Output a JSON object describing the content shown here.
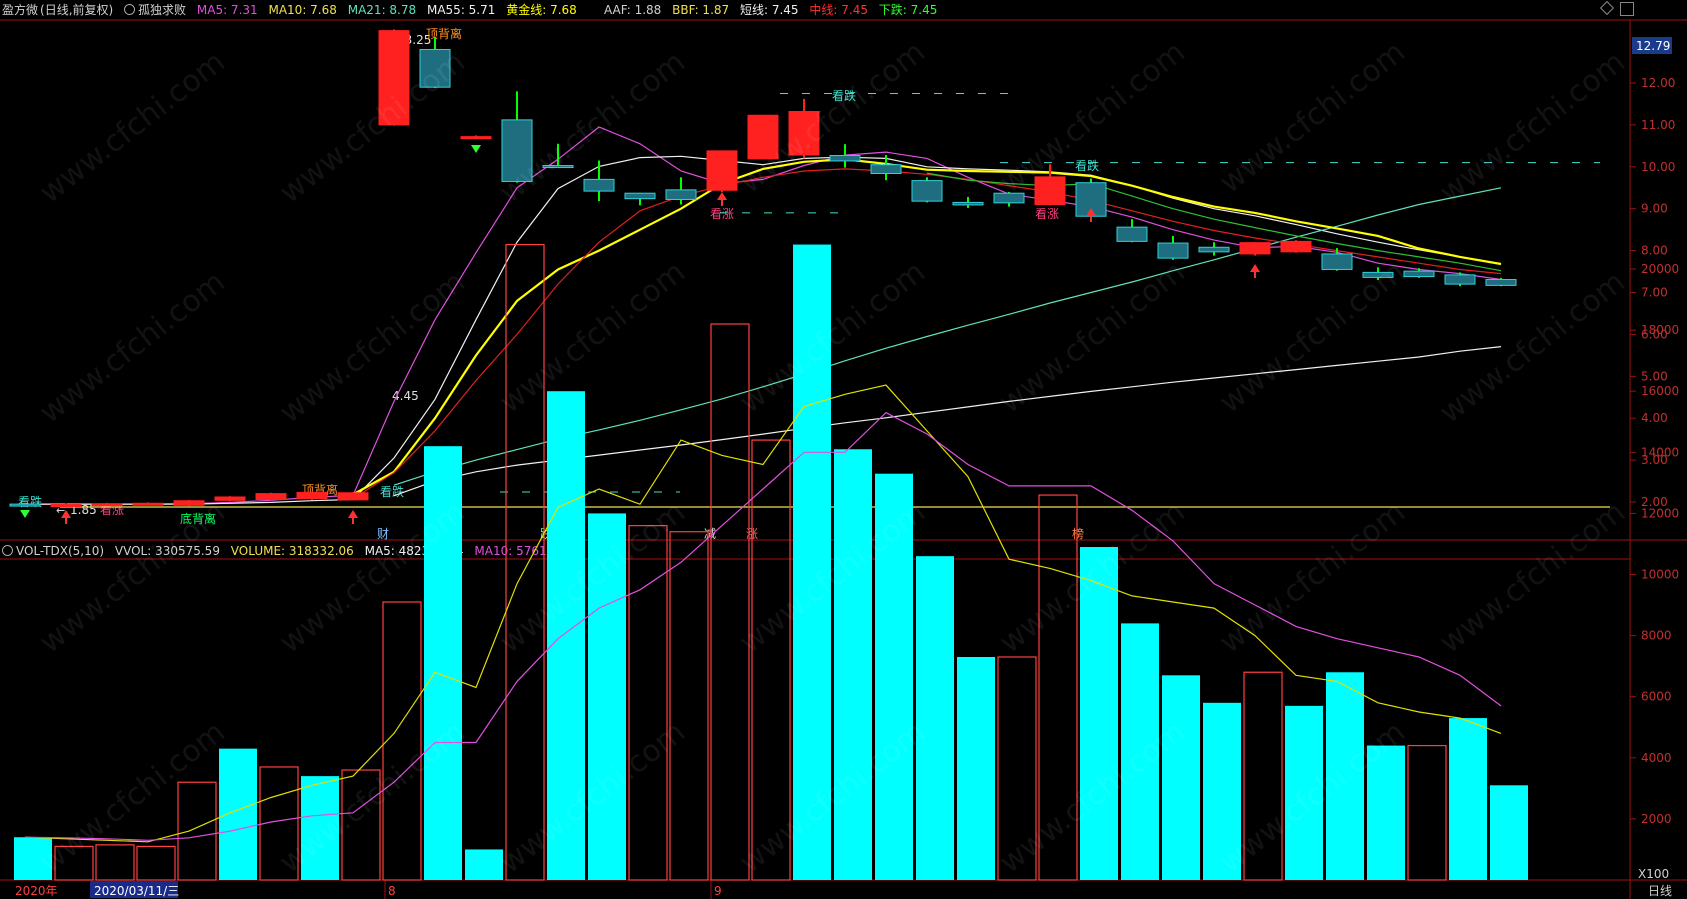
{
  "header": {
    "stock": "盈方微",
    "period": "(日线,前复权)",
    "indicator_icon": "circle-icon",
    "indicator_name": "孤独求败",
    "ma5": "MA5: 7.31",
    "ma10": "MA10: 7.68",
    "ma21": "MA21: 8.78",
    "ma55": "MA55: 5.71",
    "golden": "黄金线: 7.68",
    "aaf": "AAF: 1.88",
    "bbf": "BBF: 1.87",
    "short": "短线: 7.45",
    "mid": "中线: 7.45",
    "down": "下跌: 7.45"
  },
  "vol_header": {
    "name": "VOL-TDX(5,10)",
    "vvol": "VVOL: 330575.59",
    "volume": "VOLUME: 318332.06",
    "ma5": "MA5: 482360.94",
    "ma10": "MA10: 576196.13"
  },
  "colors": {
    "up": "#ff2020",
    "down_fill": "#1e6e80",
    "down_edge": "#2fd0d8",
    "green_tick": "#00ff00",
    "ma5": "#e050e0",
    "ma10": "#f0f0f0",
    "ma21": "#60e0c0",
    "ma55": "#f0f0f0",
    "golden": "#ffff00",
    "red_line": "#e02020",
    "vol_up": "#ff4040",
    "vol_down": "#00ffff",
    "axis": "#a01010"
  },
  "footer": {
    "year": "2020年",
    "date": "2020/03/11/三",
    "month8": "8",
    "month9": "9",
    "scale": "X100",
    "period_label": "日线"
  },
  "labels": {
    "price_badge": "12.79",
    "high": "13.25",
    "low": "1.85",
    "mid_mark": "4.45",
    "top_div1": "顶背离",
    "top_div2": "顶背离",
    "bottom_div": "底背离",
    "watch_up1": "看涨",
    "watch_up2": "看涨",
    "watch_up3": "看涨",
    "watch_down1": "看跌",
    "watch_down2": "看跌",
    "watch_down3": "看跌",
    "watch_down4": "看跌",
    "e1": "财",
    "e2": "跌",
    "e3": "减",
    "e4": "涨",
    "e5": "榜",
    "watermark": "www.cfchi.com"
  },
  "chart_data": [
    {
      "type": "candlestick",
      "title": "盈方微 (日线,前复权)",
      "y_ticks": [
        2.0,
        3.0,
        4.0,
        5.0,
        6.0,
        7.0,
        8.0,
        9.0,
        10.0,
        11.0,
        12.0
      ],
      "ylim": [
        1.6,
        13.3
      ],
      "candles": [
        [
          1.95,
          1.93,
          1.98,
          1.9
        ],
        [
          1.93,
          1.94,
          1.97,
          1.91
        ],
        [
          1.95,
          1.96,
          1.98,
          1.92
        ],
        [
          1.96,
          1.97,
          1.99,
          1.94
        ],
        [
          1.92,
          2.03,
          2.05,
          1.9
        ],
        [
          2.04,
          2.12,
          2.14,
          2.02
        ],
        [
          2.06,
          2.2,
          2.22,
          2.03
        ],
        [
          2.08,
          2.23,
          2.25,
          2.05
        ],
        [
          2.05,
          2.22,
          2.24,
          2.04
        ],
        [
          11.0,
          13.25,
          13.28,
          10.98
        ],
        [
          12.8,
          11.9,
          13.1,
          11.88
        ],
        [
          10.68,
          10.72,
          10.75,
          10.66
        ],
        [
          11.12,
          9.65,
          11.8,
          9.62
        ],
        [
          10.03,
          10.02,
          10.55,
          10.0
        ],
        [
          9.7,
          9.42,
          10.15,
          9.18
        ],
        [
          9.37,
          9.24,
          9.38,
          9.08
        ],
        [
          9.45,
          9.22,
          9.75,
          9.1
        ],
        [
          9.44,
          10.38,
          10.38,
          9.4
        ],
        [
          10.19,
          11.23,
          11.24,
          10.18
        ],
        [
          10.28,
          11.32,
          11.62,
          10.2
        ],
        [
          10.27,
          10.14,
          10.54,
          9.98
        ],
        [
          10.05,
          9.84,
          10.28,
          9.68
        ],
        [
          9.67,
          9.18,
          9.75,
          9.15
        ],
        [
          9.15,
          9.09,
          9.28,
          9.02
        ],
        [
          9.37,
          9.14,
          9.4,
          9.05
        ],
        [
          9.1,
          9.76,
          10.06,
          9.08
        ],
        [
          9.62,
          8.82,
          9.72,
          8.8
        ],
        [
          8.56,
          8.22,
          8.75,
          8.2
        ],
        [
          8.18,
          7.82,
          8.35,
          7.78
        ],
        [
          8.08,
          7.97,
          8.2,
          7.88
        ],
        [
          7.92,
          8.19,
          8.2,
          7.88
        ],
        [
          7.97,
          8.22,
          8.25,
          7.95
        ],
        [
          7.92,
          7.55,
          8.06,
          7.52
        ],
        [
          7.48,
          7.36,
          7.6,
          7.3
        ],
        [
          7.51,
          7.38,
          7.58,
          7.35
        ],
        [
          7.42,
          7.2,
          7.48,
          7.15
        ],
        [
          7.31,
          7.17,
          7.35,
          7.15
        ]
      ],
      "series": [
        {
          "name": "MA5",
          "values": [
            1.95,
            1.95,
            1.95,
            1.95,
            1.96,
            1.99,
            2.04,
            2.11,
            2.16,
            4.4,
            6.35,
            7.95,
            9.5,
            10.18,
            10.95,
            10.55,
            9.9,
            9.6,
            9.7,
            10.03,
            10.28,
            10.35,
            10.2,
            9.75,
            9.35,
            9.2,
            9.05,
            8.8,
            8.5,
            8.25,
            8.07,
            8.1,
            7.96,
            7.7,
            7.55,
            7.45,
            7.31
          ]
        },
        {
          "name": "MA10",
          "values": [
            1.95,
            1.95,
            1.95,
            1.95,
            1.95,
            1.97,
            1.99,
            2.03,
            2.06,
            3.05,
            4.45,
            6.35,
            8.2,
            9.48,
            10.01,
            10.22,
            10.25,
            10.15,
            10.05,
            10.2,
            10.23,
            10.2,
            10.0,
            9.95,
            9.92,
            9.88,
            9.8,
            9.55,
            9.25,
            9.0,
            8.83,
            8.62,
            8.4,
            8.2,
            8.02,
            7.85,
            7.68
          ]
        },
        {
          "name": "MA21",
          "values": [
            null,
            null,
            null,
            null,
            null,
            null,
            null,
            null,
            null,
            2.4,
            2.72,
            3.0,
            3.25,
            3.5,
            3.72,
            3.95,
            4.2,
            4.46,
            4.75,
            5.05,
            5.37,
            5.67,
            5.95,
            6.22,
            6.48,
            6.75,
            7.0,
            7.25,
            7.52,
            7.78,
            8.05,
            8.32,
            8.58,
            8.85,
            9.1,
            9.3,
            9.5
          ]
        },
        {
          "name": "MA55",
          "values": [
            null,
            null,
            null,
            null,
            null,
            null,
            null,
            null,
            null,
            2.15,
            2.5,
            2.72,
            2.88,
            3.0,
            3.12,
            3.24,
            3.36,
            3.49,
            3.62,
            3.76,
            3.89,
            4.01,
            4.14,
            4.27,
            4.4,
            4.52,
            4.64,
            4.75,
            4.86,
            4.96,
            5.06,
            5.16,
            5.26,
            5.36,
            5.46,
            5.6,
            5.71
          ]
        },
        {
          "name": "黄金线",
          "values": [
            null,
            null,
            null,
            null,
            null,
            null,
            null,
            null,
            2.18,
            2.72,
            4.0,
            5.5,
            6.8,
            7.55,
            8.0,
            8.5,
            9.0,
            9.6,
            9.95,
            10.12,
            10.18,
            10.07,
            9.93,
            9.9,
            9.88,
            9.86,
            9.78,
            9.55,
            9.28,
            9.05,
            8.9,
            8.7,
            8.53,
            8.35,
            8.05,
            7.85,
            7.68
          ]
        },
        {
          "name": "红线",
          "values": [
            null,
            null,
            null,
            null,
            null,
            null,
            null,
            null,
            2.08,
            2.7,
            3.7,
            4.9,
            6.0,
            7.2,
            8.2,
            8.95,
            9.3,
            9.55,
            9.75,
            9.9,
            9.95,
            9.9,
            9.82,
            9.7,
            9.55,
            9.4,
            9.2,
            8.95,
            8.7,
            8.48,
            8.3,
            8.15,
            8.0,
            7.85,
            7.7,
            7.55,
            7.45
          ]
        },
        {
          "name": "绿线",
          "values": [
            null,
            null,
            null,
            null,
            null,
            null,
            null,
            null,
            null,
            null,
            null,
            null,
            null,
            null,
            null,
            null,
            null,
            null,
            null,
            null,
            null,
            null,
            9.85,
            9.68,
            9.6,
            9.55,
            9.6,
            9.3,
            9.0,
            8.75,
            8.55,
            8.35,
            8.17,
            8.0,
            7.85,
            7.7,
            7.52
          ]
        }
      ]
    },
    {
      "type": "bar",
      "title": "VOL-TDX(5,10)",
      "unit": "X100",
      "y_ticks": [
        2000,
        4000,
        6000,
        8000,
        10000,
        12000,
        14000,
        16000,
        18000,
        20000
      ],
      "ylim": [
        0,
        21200
      ],
      "values": [
        1400,
        1100,
        1150,
        1100,
        3200,
        4300,
        3700,
        3400,
        3600,
        9100,
        14200,
        1000,
        20800,
        16000,
        12000,
        11600,
        11400,
        18200,
        14400,
        20800,
        14100,
        13300,
        10600,
        7300,
        7300,
        12600,
        10900,
        8400,
        6700,
        5800,
        6800,
        5700,
        6800,
        4400,
        4400,
        5300,
        3100
      ],
      "up": [
        false,
        true,
        true,
        true,
        true,
        false,
        true,
        false,
        true,
        true,
        false,
        false,
        true,
        false,
        false,
        true,
        true,
        true,
        true,
        false,
        false,
        false,
        false,
        false,
        true,
        true,
        false,
        false,
        false,
        false,
        true,
        false,
        false,
        false,
        true,
        false,
        false
      ],
      "series": [
        {
          "name": "MA5",
          "values": [
            1400,
            1350,
            1300,
            1250,
            1600,
            2200,
            2700,
            3100,
            3400,
            4800,
            6800,
            6300,
            9700,
            12200,
            12800,
            12300,
            14400,
            13900,
            13600,
            15500,
            15900,
            16200,
            14700,
            13200,
            10500,
            10200,
            9800,
            9300,
            9100,
            8900,
            8000,
            6700,
            6500,
            5800,
            5500,
            5300,
            4800
          ]
        },
        {
          "name": "MA10",
          "values": [
            1400,
            1380,
            1350,
            1300,
            1380,
            1600,
            1900,
            2100,
            2200,
            3200,
            4500,
            4500,
            6500,
            7900,
            8900,
            9500,
            10400,
            11600,
            12800,
            14000,
            14000,
            15300,
            14600,
            13600,
            12900,
            12900,
            12900,
            12100,
            11100,
            9700,
            9000,
            8300,
            7900,
            7600,
            7300,
            6700,
            5700
          ]
        }
      ]
    }
  ]
}
